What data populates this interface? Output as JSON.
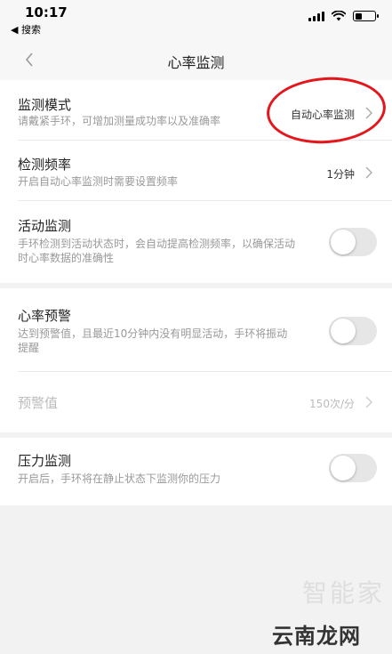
{
  "status_bar": {
    "time": "10:17",
    "back_app": "◀ 搜索"
  },
  "nav": {
    "title": "心率监测",
    "back_icon": "chevron-left-icon"
  },
  "settings": [
    {
      "title": "监测模式",
      "subtitle": "请戴紧手环，可增加测量成功率以及准确率",
      "value": "自动心率监测",
      "control": "chevron"
    },
    {
      "title": "检测频率",
      "subtitle": "开启自动心率监测时需要设置频率",
      "value": "1分钟",
      "control": "chevron"
    },
    {
      "title": "活动监测",
      "subtitle_line1": "手环检测到活动状态时，会自动提高检测频率，以确保活动",
      "subtitle_line2": "时心率数据的准确性",
      "control": "toggle",
      "enabled": false
    },
    {
      "title": "心率预警",
      "subtitle_line1": "达到预警值，且最近10分钟内没有明显活动，手环将振动",
      "subtitle_line2": "提醒",
      "control": "toggle",
      "enabled": false
    },
    {
      "title": "预警值",
      "value": "150次/分",
      "control": "chevron",
      "disabled": true
    },
    {
      "title": "压力监测",
      "subtitle": "开启后，手环将在静止状态下监测你的压力",
      "control": "toggle",
      "enabled": false
    }
  ],
  "colors": {
    "annotation_circle": "#e4161b",
    "toggle_off": "#e6e6e6",
    "background": "#f2f2f2"
  },
  "watermarks": {
    "top": "智能家",
    "bottom": "云南龙网"
  }
}
